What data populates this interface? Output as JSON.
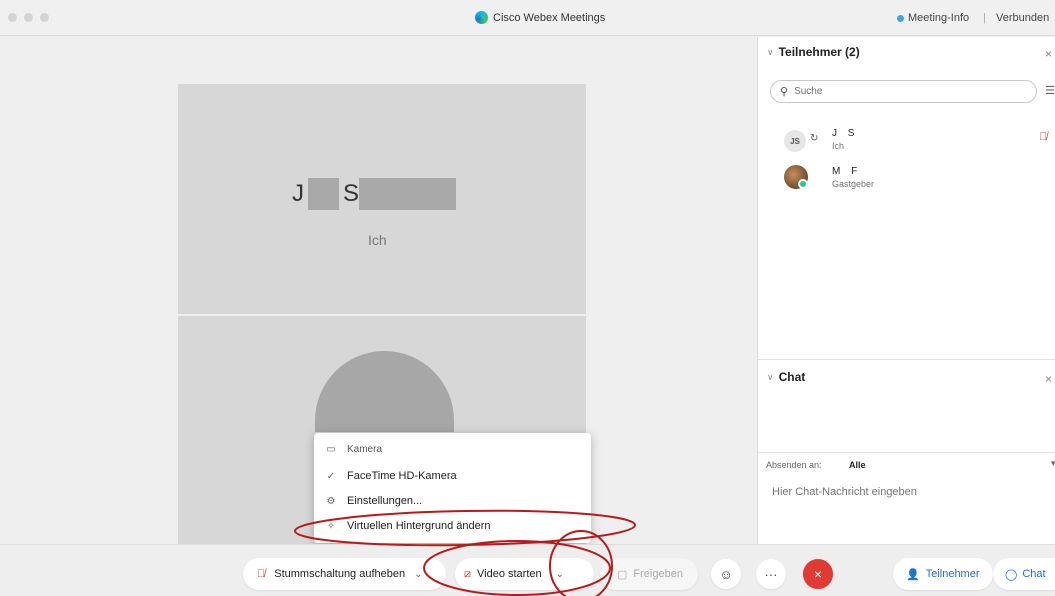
{
  "titlebar": {
    "app_title": "Cisco Webex Meetings",
    "meeting_info": "Meeting-Info",
    "separator": "|",
    "status": "Verbunden"
  },
  "stage": {
    "self_tile": {
      "name_first": "J",
      "name_last": "S",
      "subtitle": "Ich"
    }
  },
  "camera_menu": {
    "header": "Kamera",
    "items": [
      {
        "label": "FaceTime HD-Kamera",
        "icon": "check-icon",
        "selected": true
      },
      {
        "label": "Einstellungen...",
        "icon": "gear-icon"
      },
      {
        "label": "Virtuellen Hintergrund ändern",
        "icon": "magic-wand-icon"
      }
    ]
  },
  "participants_panel": {
    "title": "Teilnehmer (2)",
    "search_placeholder": "Suche",
    "participants": [
      {
        "initials": "JS",
        "name": "J S",
        "role": "Ich",
        "muted": true
      },
      {
        "initials": "",
        "name": "M F",
        "role": "Gastgeber"
      }
    ]
  },
  "chat_panel": {
    "title": "Chat",
    "send_to_label": "Absenden an:",
    "send_to_value": "Alle",
    "input_placeholder": "Hier Chat-Nachricht eingeben"
  },
  "toolbar": {
    "unmute_label": "Stummschaltung aufheben",
    "video_label": "Video starten",
    "share_label": "Freigeben",
    "more_label": "···",
    "end_label": "×",
    "participants_label": "Teilnehmer",
    "chat_label": "Chat"
  },
  "colors": {
    "end_call": "#e03a32",
    "accent_blue": "#1f6fd6",
    "muted_red": "#d03a2f",
    "annotation_red": "#b81a1a"
  }
}
